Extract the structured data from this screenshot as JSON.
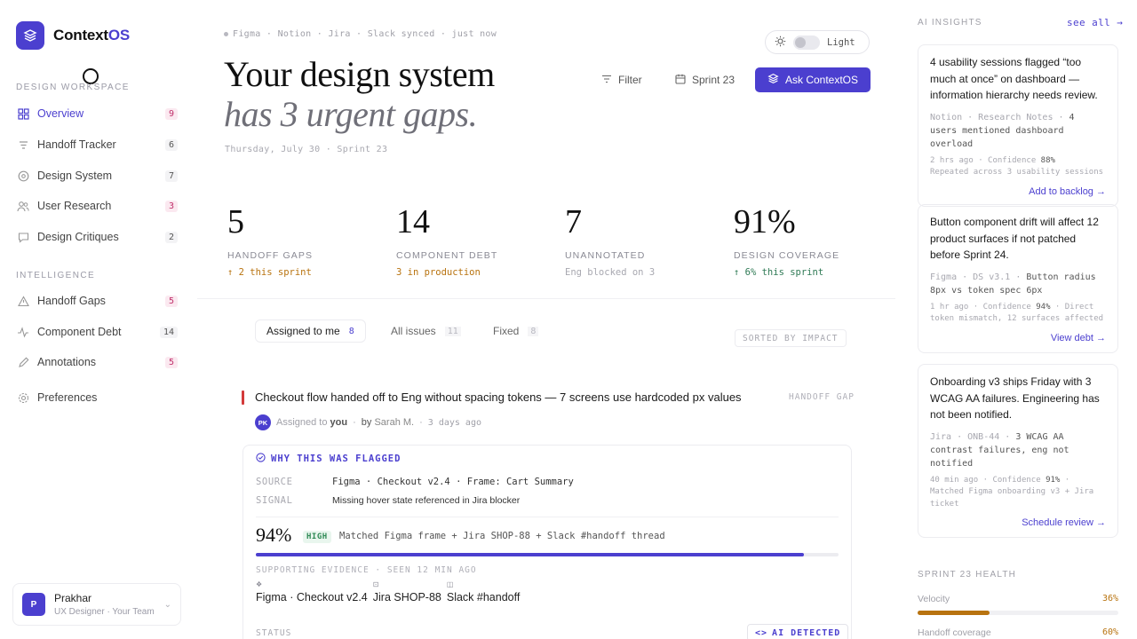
{
  "app": {
    "name_main": "Context",
    "name_accent": "OS"
  },
  "sidebar": {
    "section1_label": "DESIGN WORKSPACE",
    "items1": [
      {
        "label": "Overview",
        "count": "9"
      },
      {
        "label": "Handoff Tracker",
        "count": "6"
      },
      {
        "label": "Design System",
        "count": "7"
      },
      {
        "label": "User Research",
        "count": "3"
      },
      {
        "label": "Design Critiques",
        "count": "2"
      }
    ],
    "section2_label": "INTELLIGENCE",
    "items2": [
      {
        "label": "Handoff Gaps",
        "count": "5"
      },
      {
        "label": "Component Debt",
        "count": "14"
      },
      {
        "label": "Annotations",
        "count": "5"
      }
    ],
    "preferences_label": "Preferences",
    "user": {
      "initial": "P",
      "name": "Prakhar",
      "role": "UX Designer · Your Team"
    }
  },
  "header": {
    "sync_line": "Figma · Notion · Jira · Slack synced · just now",
    "hero_line1": "Your design system",
    "hero_line2": "has 3 urgent gaps.",
    "dateline": "Thursday, July 30 · Sprint 23",
    "theme_label": "Light",
    "filter_label": "Filter",
    "sprint_label": "Sprint 23",
    "ask_label": "Ask ContextOS"
  },
  "stats": [
    {
      "value": "5",
      "label": "HANDOFF GAPS",
      "sub": "↑ 2 this sprint",
      "sub_color": "#b8730f"
    },
    {
      "value": "14",
      "label": "COMPONENT DEBT",
      "sub": "3 in production",
      "sub_color": "#b8730f"
    },
    {
      "value": "7",
      "label": "UNANNOTATED",
      "sub": "Eng blocked on 3",
      "sub_color": "#a8a8b0"
    },
    {
      "value": "91%",
      "label": "DESIGN COVERAGE",
      "sub": "↑ 6% this sprint",
      "sub_color": "#2f7a55"
    }
  ],
  "tabs": [
    {
      "label": "Assigned to me",
      "count": "8"
    },
    {
      "label": "All issues",
      "count": "11"
    },
    {
      "label": "Fixed",
      "count": "8"
    }
  ],
  "sorted_label": "SORTED BY IMPACT",
  "issue": {
    "title": "Checkout flow handed off to Eng without spacing tokens — 7 screens use hardcoded px values",
    "tag": "HANDOFF GAP",
    "avatar": "PK",
    "assigned_prefix": "Assigned to",
    "assigned_to": "you",
    "by_prefix": "by",
    "by_name": "Sarah M.",
    "age": "3 days ago",
    "flag_header": "WHY THIS WAS FLAGGED",
    "source_key": "SOURCE",
    "source_val": "Figma · Checkout v2.4 · Frame: Cart Summary",
    "signal_key": "SIGNAL",
    "signal_val": "Missing hover state referenced in Jira blocker",
    "confidence": "94%",
    "confidence_fraction": 0.94,
    "confidence_badge": "HIGH",
    "confidence_desc": "Matched Figma frame + Jira SHOP-88 + Slack #handoff thread",
    "evidence_header": "SUPPORTING EVIDENCE · SEEN 12 MIN AGO",
    "evidence": [
      "Figma · Checkout v2.4",
      "Jira SHOP-88",
      "Slack #handoff"
    ],
    "status_label": "STATUS",
    "ai_badge": "AI DETECTED"
  },
  "insights": {
    "title": "AI INSIGHTS",
    "see_all": "see all →",
    "cards": [
      {
        "text": "4 usability sessions flagged “too much at once” on dashboard — information hierarchy needs review.",
        "src_muted": "Notion · Research Notes ·",
        "src_main": "4 users mentioned dashboard overload",
        "meta_time": "2 hrs ago",
        "meta_conf_label": "Confidence",
        "meta_conf_val": "88%",
        "meta_note": "Repeated across 3 usability sessions",
        "cta": "Add to backlog →"
      },
      {
        "text": "Button component drift will affect 12 product surfaces if not patched before Sprint 24.",
        "src_muted": "Figma · DS v3.1 ·",
        "src_main": "Button radius 8px vs token spec 6px",
        "meta_time": "1 hr ago",
        "meta_conf_label": "Confidence",
        "meta_conf_val": "94%",
        "meta_note": "Direct token mismatch, 12 surfaces affected",
        "cta": "View debt →"
      },
      {
        "text": "Onboarding v3 ships Friday with 3 WCAG AA failures. Engineering has not been notified.",
        "src_muted": "Jira · ONB-44 ·",
        "src_main": "3 WCAG AA contrast failures, eng not notified",
        "meta_time": "40 min ago",
        "meta_conf_label": "Confidence",
        "meta_conf_val": "91%",
        "meta_note": "Matched Figma onboarding v3 + Jira ticket",
        "cta": "Schedule review →"
      }
    ]
  },
  "health": {
    "title": "SPRINT 23 HEALTH",
    "velocity_label": "Velocity",
    "velocity_val": "36%",
    "velocity_fraction": 0.36,
    "coverage_label": "Handoff coverage",
    "coverage_val": "60%"
  }
}
